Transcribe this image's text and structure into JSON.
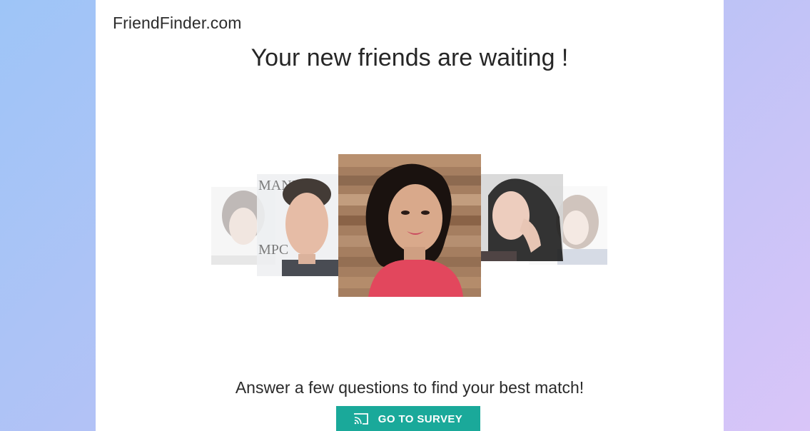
{
  "brand": {
    "name": "FriendFinder.com"
  },
  "hero": {
    "headline": "Your new friends are waiting !",
    "photos": [
      {
        "name": "profile-photo-far-left",
        "description": "woman"
      },
      {
        "name": "profile-photo-left",
        "description": "man"
      },
      {
        "name": "profile-photo-center",
        "description": "woman smiling"
      },
      {
        "name": "profile-photo-right",
        "description": "woman"
      },
      {
        "name": "profile-photo-far-right",
        "description": "woman"
      }
    ]
  },
  "cta": {
    "subtext": "Answer a few questions to find your best match!",
    "button_label": "GO TO SURVEY",
    "button_icon": "cast-icon",
    "button_color": "#1aa99a"
  }
}
